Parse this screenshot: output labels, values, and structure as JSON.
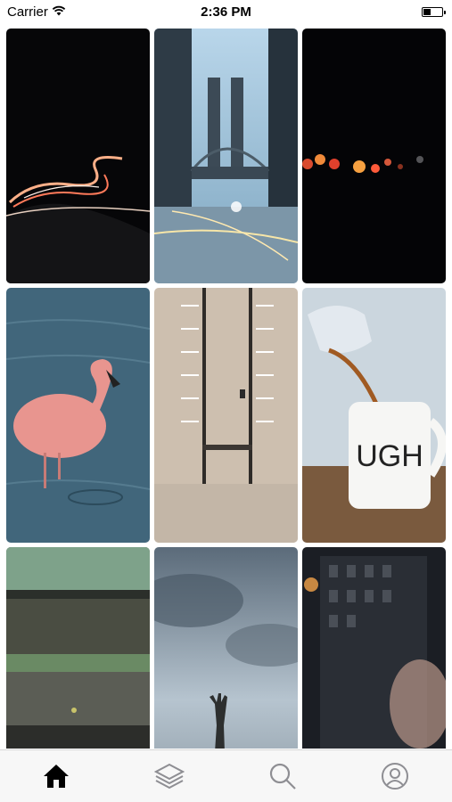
{
  "status_bar": {
    "carrier": "Carrier",
    "time": "2:36 PM",
    "battery_level": 0.4
  },
  "grid": {
    "photos": [
      {
        "subject": "light trails on a dark road",
        "icon": "photo-light-trails"
      },
      {
        "subject": "bridge at dusk over city street",
        "icon": "photo-bridge"
      },
      {
        "subject": "bokeh city lights at night",
        "icon": "photo-bokeh"
      },
      {
        "subject": "pink flamingo in water",
        "icon": "photo-flamingo"
      },
      {
        "subject": "aerial view of parking lot",
        "icon": "photo-parking-lot"
      },
      {
        "subject": "coffee pouring into mug",
        "icon": "photo-coffee-mug",
        "text": "UGH"
      },
      {
        "subject": "green car beside puddle",
        "icon": "photo-car-puddle"
      },
      {
        "subject": "hand rising from sea under cloudy sky",
        "icon": "photo-hand-sea"
      },
      {
        "subject": "portrait reflection in window",
        "icon": "photo-portrait"
      }
    ]
  },
  "tab_bar": {
    "tabs": [
      {
        "id": "home",
        "icon": "home-icon",
        "active": true
      },
      {
        "id": "layers",
        "icon": "layers-icon",
        "active": false
      },
      {
        "id": "search",
        "icon": "search-icon",
        "active": false
      },
      {
        "id": "profile",
        "icon": "profile-icon",
        "active": false
      }
    ],
    "active_color": "#000000",
    "inactive_color": "#8e8e93"
  }
}
